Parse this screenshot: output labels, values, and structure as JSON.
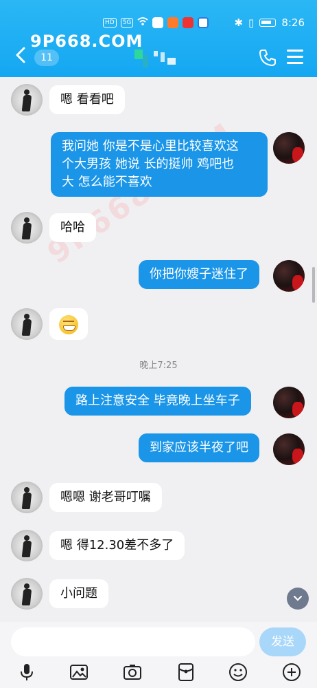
{
  "status": {
    "time": "8:26",
    "hd_chip": "HD",
    "net_chip": "5G"
  },
  "header": {
    "watermark": "9P668.COM",
    "back_icon": "chevron-left-icon",
    "unread_count": "11",
    "phone_icon": "phone-icon",
    "menu_icon": "menu-icon"
  },
  "messages": [
    {
      "side": "left",
      "text": "嗯 看看吧"
    },
    {
      "side": "right",
      "lines": [
        "我问她 你是不是心里比较喜欢这",
        "个大男孩  她说  长的挺帅  鸡吧也",
        "大  怎么能不喜欢"
      ]
    },
    {
      "side": "left",
      "text": "哈哈"
    },
    {
      "side": "right",
      "text": "你把你嫂子迷住了"
    },
    {
      "side": "left",
      "emoji": "grinning-squint-emoji"
    },
    {
      "side": "right",
      "text": "路上注意安全  毕竟晚上坐车子"
    },
    {
      "side": "right",
      "text": "到家应该半夜了吧"
    },
    {
      "side": "left",
      "text": "嗯嗯 谢老哥叮嘱"
    },
    {
      "side": "left",
      "text": "嗯 得12.30差不多了"
    },
    {
      "side": "left",
      "text": "小问题"
    }
  ],
  "timestamp": "晚上7:25",
  "input": {
    "placeholder": "",
    "send_label": "发送"
  },
  "toolbar": [
    "mic-icon",
    "image-icon",
    "camera-icon",
    "red-packet-icon",
    "emoji-icon",
    "plus-icon"
  ]
}
